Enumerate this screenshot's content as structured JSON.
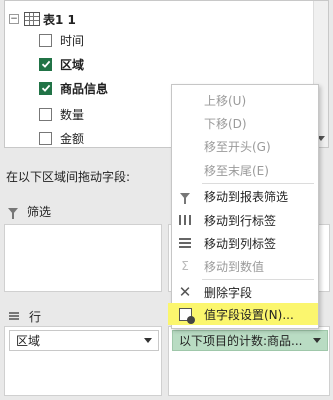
{
  "field_list": {
    "table_name": "表1 1",
    "fields": [
      {
        "label": "时间",
        "checked": false,
        "bold": false
      },
      {
        "label": "区域",
        "checked": true,
        "bold": true
      },
      {
        "label": "商品信息",
        "checked": true,
        "bold": true
      },
      {
        "label": "数量",
        "checked": false,
        "bold": false
      },
      {
        "label": "金额",
        "checked": false,
        "bold": false
      }
    ]
  },
  "areas_hint": "在以下区域间拖动字段:",
  "filters": {
    "label": "筛选"
  },
  "rows": {
    "label": "行",
    "item": "区域"
  },
  "values": {
    "item": "以下项目的计数:商品..."
  },
  "context_menu": {
    "items": [
      {
        "label": "上移(U)",
        "disabled": true,
        "icon": ""
      },
      {
        "label": "下移(D)",
        "disabled": true,
        "icon": ""
      },
      {
        "label": "移至开头(G)",
        "disabled": true,
        "icon": ""
      },
      {
        "label": "移至末尾(E)",
        "disabled": true,
        "icon": ""
      },
      {
        "label": "移动到报表筛选",
        "disabled": false,
        "icon": "filter-icon"
      },
      {
        "label": "移动到行标签",
        "disabled": false,
        "icon": "row-labels-icon"
      },
      {
        "label": "移动到列标签",
        "disabled": false,
        "icon": "column-labels-icon"
      },
      {
        "label": "移动到数值",
        "disabled": true,
        "icon": "sigma-icon"
      },
      {
        "label": "删除字段",
        "disabled": false,
        "icon": "delete-x-icon"
      },
      {
        "label": "值字段设置(N)...",
        "disabled": false,
        "highlighted": true,
        "icon": "field-settings-icon"
      }
    ]
  },
  "colors": {
    "highlight": "#fbf66e",
    "checkbox": "#217346",
    "value_area": "#b9dcc3"
  }
}
